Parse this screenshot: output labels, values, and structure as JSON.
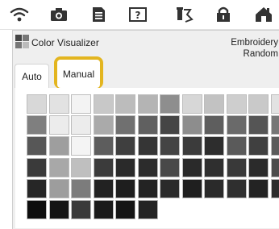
{
  "statusbar": {
    "icons": [
      "wifi-icon",
      "camera-icon",
      "document-icon",
      "help-icon",
      "thread-icon",
      "lock-icon",
      "home-icon"
    ]
  },
  "app": {
    "title": "Color Visualizer",
    "right_line1": "Embroidery",
    "right_line2": "Random"
  },
  "tabs": {
    "auto_label": "Auto",
    "manual_label": "Manual",
    "selected": "Manual",
    "highlight_color": "#e3b51f"
  },
  "swatches": [
    [
      "#d8d8d8",
      "#e2e2e2",
      "#f3f3f3",
      "#c8c8c8",
      "#bcbcbc",
      "#b4b4b4",
      "#8e8e8e",
      "#d7d7d7",
      "#c2c2c2",
      "#cecece",
      "#c9c9c9",
      "#e2e2e2"
    ],
    [
      "#7f7f7f",
      "#ececec",
      "#ececec",
      "#aaaaaa",
      "#707070",
      "#606060",
      "#454545",
      "#8d8d8d",
      "#5e5e5e",
      "#6a6a6a",
      "#555555",
      "#767676"
    ],
    [
      "#575757",
      "#9e9e9e",
      "#f4f4f4",
      "#5d5d5d",
      "#3f3f3f",
      "#353535",
      "#444444",
      "#3b3b3b",
      "#2d2d2d",
      "#5a5a5a",
      "#404040",
      "#5b5b5b"
    ],
    [
      "#3a3a3a",
      "#a8a8a8",
      "#bfbfbf",
      "#3b3b3b",
      "#2a2a2a",
      "#2c2c2c",
      "#494949",
      "#2a2a2a",
      "#2f2f2f",
      "#393939",
      "#2b2b2b",
      "#4c4c4c"
    ],
    [
      "#262626",
      "#9d9d9d",
      "#7c7c7c",
      "#222222",
      "#1e1e1e",
      "#232323",
      "#2a2a2a",
      "#1f1f1f",
      "#2a2a2a",
      "#2f2f2f",
      "#232323",
      "#2d2d2d"
    ],
    [
      "#0d0d0d",
      "#141414",
      "#3a3a3a",
      "#1a1a1a",
      "#151515",
      "#232323"
    ]
  ]
}
